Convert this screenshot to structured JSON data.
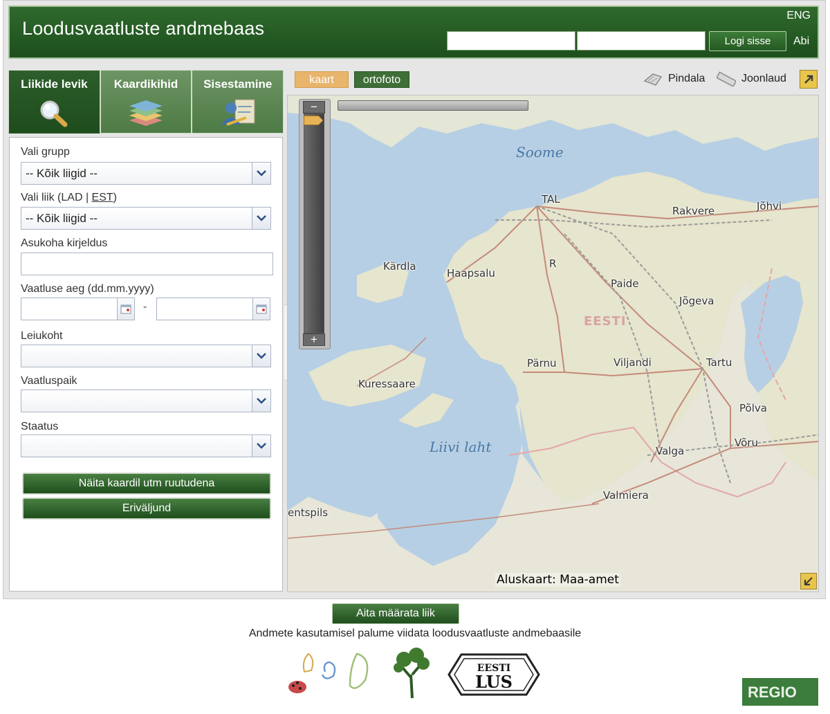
{
  "header": {
    "title": "Loodusvaatluste andmebaas",
    "lang": "ENG",
    "login_button": "Logi sisse",
    "help": "Abi"
  },
  "tabs": [
    {
      "label": "Liikide levik",
      "icon": "search-icon"
    },
    {
      "label": "Kaardikihid",
      "icon": "layers-icon"
    },
    {
      "label": "Sisestamine",
      "icon": "data-entry-icon"
    }
  ],
  "form": {
    "group_label": "Vali grupp",
    "group_value": "-- Kõik liigid --",
    "species_label_prefix": "Vali liik (LAD | ",
    "species_label_link": "EST",
    "species_label_suffix": ")",
    "species_value": "-- Kõik liigid --",
    "location_label": "Asukoha kirjeldus",
    "time_label": "Vaatluse aeg (dd.mm.yyyy)",
    "date_separator": "-",
    "find_label": "Leiukoht",
    "place_label": "Vaatluspaik",
    "status_label": "Staatus",
    "show_grid_button": "Näita kaardil utm ruutudena",
    "export_button": "Eriväljund"
  },
  "map_toolbar": {
    "layer_map": "kaart",
    "layer_ortho": "ortofoto",
    "area_tool": "Pindala",
    "ruler_tool": "Joonlaud"
  },
  "map": {
    "places": [
      "TAL",
      "Rakvere",
      "Jõhvi",
      "Kärdla",
      "Haapsalu",
      "R",
      "Paide",
      "Jõgeva",
      "Pärnu",
      "Viljandi",
      "Tartu",
      "Kuressaare",
      "Põlva",
      "Võru",
      "Valga",
      "Valmiera",
      "entspils"
    ],
    "sea_labels": [
      "Soome",
      "Liivi laht"
    ],
    "country_label": "EESTI",
    "attribution": "Aluskaart: Maa-amet"
  },
  "footer": {
    "help_identify_button": "Aita määrata liik",
    "citation": "Andmete kasutamisel palume viidata loodusvaatluste andmebaasile",
    "logo_lus_text": "EESTI LUS",
    "logo_regio_text": "REGIO"
  }
}
